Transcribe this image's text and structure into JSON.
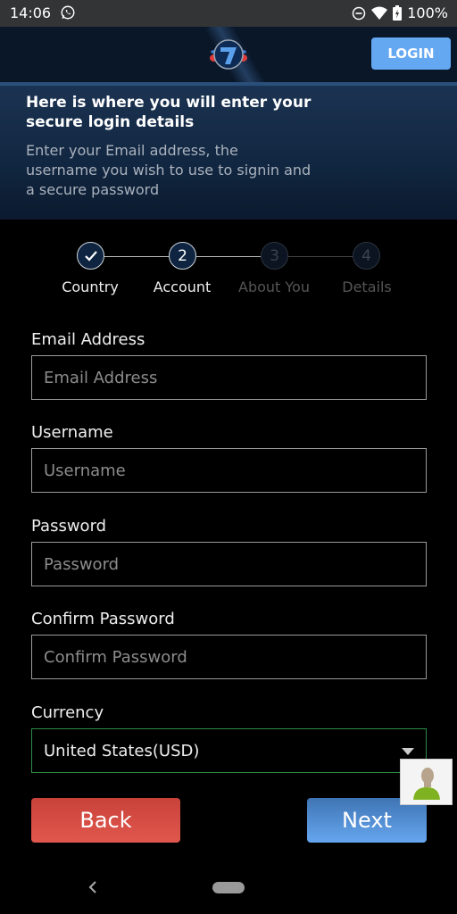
{
  "status_bar": {
    "time": "14:06",
    "battery": "100%",
    "icons": [
      "whatsapp-icon",
      "dnd-icon",
      "wifi-icon",
      "battery-charging-icon"
    ]
  },
  "header": {
    "logo": "lucky-7-logo",
    "login_label": "LOGIN"
  },
  "intro": {
    "title": "Here is where you will enter your secure login details",
    "description": "Enter your Email address, the username you wish to use to signin and a secure password"
  },
  "stepper": {
    "steps": [
      {
        "number": "1",
        "label": "Country",
        "state": "completed"
      },
      {
        "number": "2",
        "label": "Account",
        "state": "active"
      },
      {
        "number": "3",
        "label": "About You",
        "state": "inactive"
      },
      {
        "number": "4",
        "label": "Details",
        "state": "inactive"
      }
    ]
  },
  "form": {
    "email": {
      "label": "Email Address",
      "placeholder": "Email Address",
      "value": ""
    },
    "username": {
      "label": "Username",
      "placeholder": "Username",
      "value": ""
    },
    "password": {
      "label": "Password",
      "placeholder": "Password",
      "value": ""
    },
    "confirm_password": {
      "label": "Confirm Password",
      "placeholder": "Confirm Password",
      "value": ""
    },
    "currency": {
      "label": "Currency",
      "selected": "United States(USD)"
    }
  },
  "buttons": {
    "back": "Back",
    "next": "Next"
  },
  "colors": {
    "login_button": "#64a8f2",
    "back_button": "#d44c43",
    "next_button": "#4f8ed6",
    "select_border": "#2e8b47",
    "header_bg": "#0a1729"
  }
}
